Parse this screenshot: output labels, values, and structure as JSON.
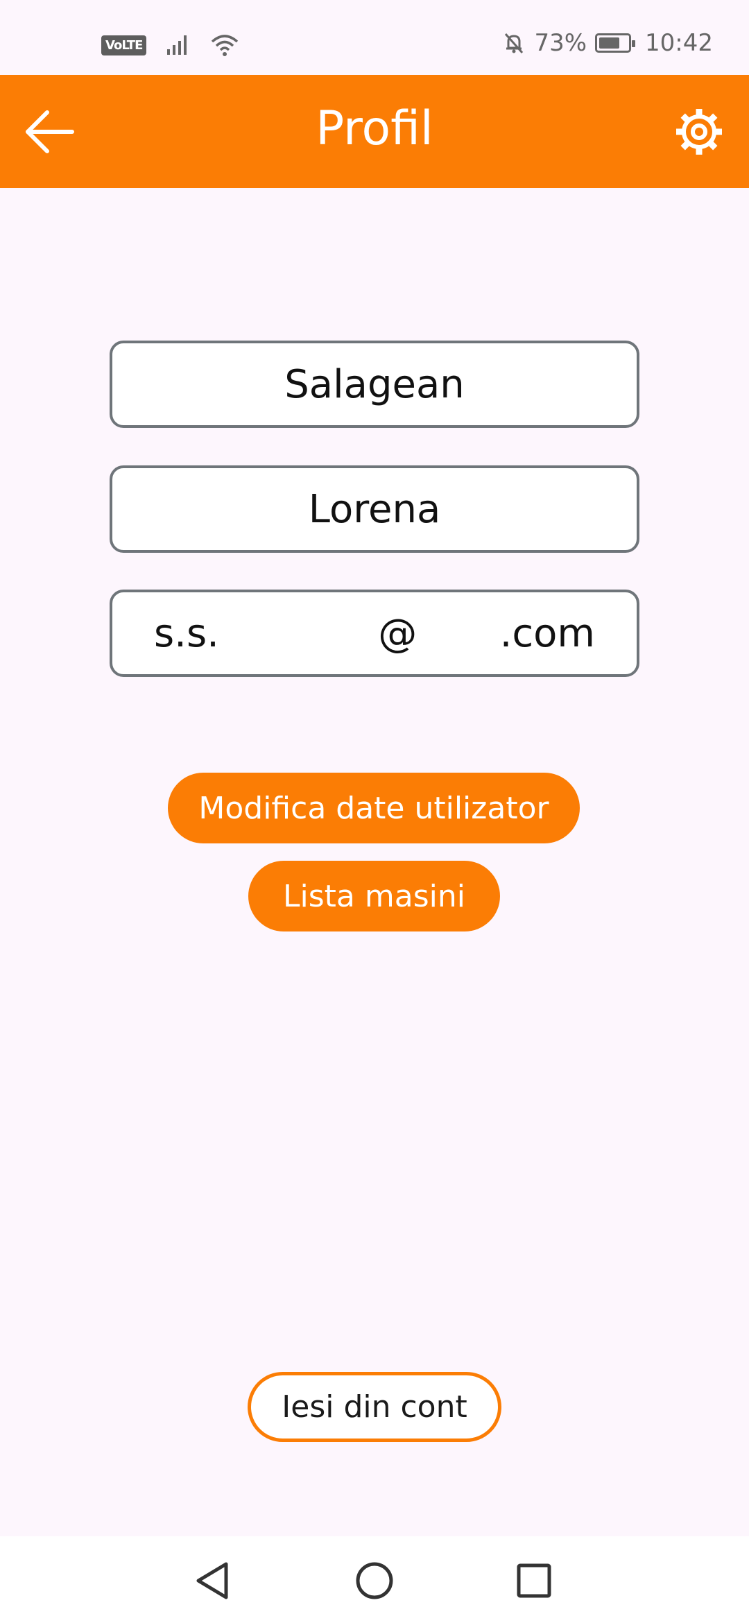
{
  "status_bar": {
    "volte": "VoLTE",
    "battery_percent": "73%",
    "battery_level": 0.73,
    "time": "10:42",
    "icons": [
      "signal-icon",
      "wifi-icon",
      "mute-bell-icon",
      "battery-icon"
    ]
  },
  "header": {
    "title": "Profil",
    "back_icon": "arrow-left-icon",
    "settings_icon": "gear-icon",
    "color": "#fb7d05"
  },
  "profile": {
    "surname": "Salagean",
    "first_name": "Lorena",
    "email_parts": [
      "s.s.",
      "@",
      ".com"
    ]
  },
  "actions": {
    "modify_label": "Modifica date utilizator",
    "cars_label": "Lista masini",
    "logout_label": "Iesi din cont"
  },
  "nav": {
    "back_icon": "triangle-back-icon",
    "home_icon": "circle-home-icon",
    "recent_icon": "square-recents-icon"
  }
}
